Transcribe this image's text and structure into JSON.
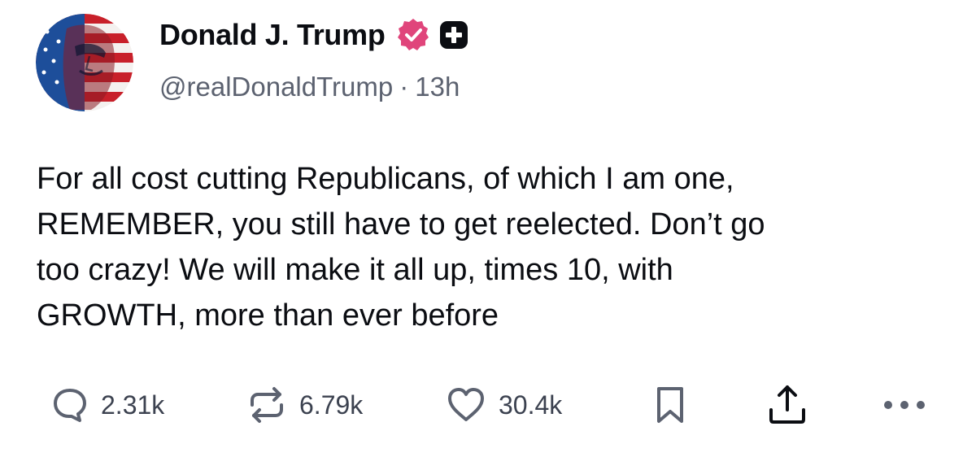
{
  "author": {
    "display_name": "Donald J. Trump",
    "handle": "@realDonaldTrump",
    "separator": "·",
    "timestamp": "13h",
    "avatar_icon": "avatar-flag-portrait",
    "verified_icon": "verified-badge-icon",
    "verified_color": "#e0457b",
    "plus_icon": "plus-badge-icon"
  },
  "post": {
    "text": "For all cost cutting Republicans, of which I am one,\nREMEMBER, you still have to get reelected. Don’t go\ntoo crazy! We will make it all up, times 10, with\nGROWTH, more than ever before"
  },
  "actions": {
    "replies": {
      "icon": "reply-icon",
      "count": "2.31k"
    },
    "reposts": {
      "icon": "repost-icon",
      "count": "6.79k"
    },
    "likes": {
      "icon": "heart-icon",
      "count": "30.4k"
    },
    "bookmark": {
      "icon": "bookmark-icon"
    },
    "share": {
      "icon": "share-icon"
    },
    "more": {
      "icon": "more-dots-icon"
    }
  }
}
